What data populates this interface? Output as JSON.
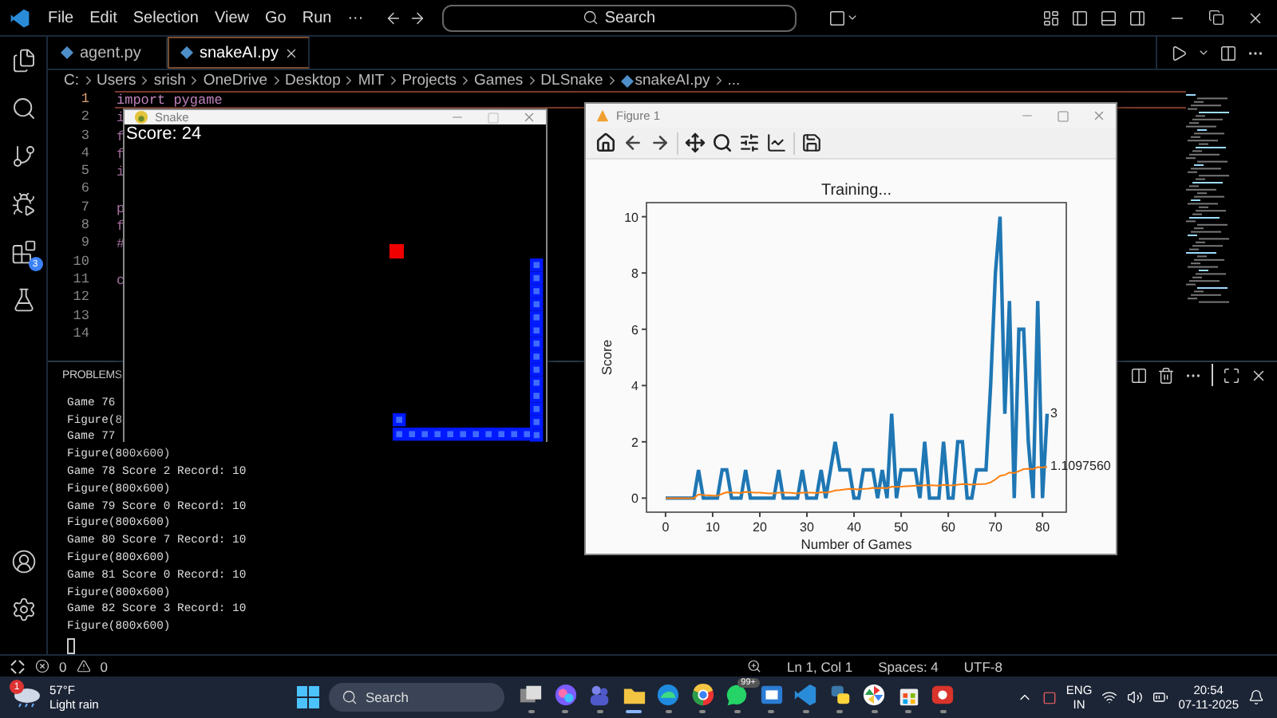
{
  "titlebar": {
    "menus": [
      "File",
      "Edit",
      "Selection",
      "View",
      "Go",
      "Run",
      "···"
    ],
    "search": {
      "placeholder": "Search"
    }
  },
  "activity_bar": {
    "extensions_badge": "3"
  },
  "tabs": [
    {
      "label": "agent.py",
      "selected": false
    },
    {
      "label": "snakeAI.py",
      "selected": true
    }
  ],
  "breadcrumb": [
    "C:",
    "Users",
    "srish",
    "OneDrive",
    "Desktop",
    "MIT",
    "Projects",
    "Games",
    "DLSnake",
    "snakeAI.py",
    "..."
  ],
  "editor": {
    "lines": [
      {
        "number": "1",
        "text": "import pygame",
        "current": true
      },
      {
        "number": "2",
        "text": "i",
        "current": false
      },
      {
        "number": "3",
        "text": "f",
        "current": false
      },
      {
        "number": "4",
        "text": "f",
        "current": false
      },
      {
        "number": "5",
        "text": "i",
        "current": false
      },
      {
        "number": "6",
        "current": false
      },
      {
        "number": "7",
        "text": "p",
        "current": false
      },
      {
        "number": "8",
        "text": "f",
        "current": false
      },
      {
        "number": "9",
        "text": "#",
        "current": false
      },
      {
        "number": "10",
        "current": false
      },
      {
        "number": "11",
        "text": "c",
        "current": false
      },
      {
        "number": "12",
        "current": false
      },
      {
        "number": "13",
        "current": false
      },
      {
        "number": "14",
        "current": false
      }
    ]
  },
  "panel": {
    "tab": "PROBLEMS",
    "terminal_lines": [
      "Game 76",
      "Figure(8",
      "Game 77",
      "Figure(800x600)",
      "Game 78 Score 2 Record: 10",
      "Figure(800x600)",
      "Game 79 Score 0 Record: 10",
      "Figure(800x600)",
      "Game 80 Score 7 Record: 10",
      "Figure(800x600)",
      "Game 81 Score 0 Record: 10",
      "Figure(800x600)",
      "Game 82 Score 3 Record: 10",
      "Figure(800x600)"
    ]
  },
  "snake_window": {
    "title": "Snake",
    "score": "Score: 24"
  },
  "figure_window": {
    "title": "Figure 1",
    "chart_data": {
      "type": "line",
      "title": "Training...",
      "xlabel": "Number of Games",
      "ylabel": "Score",
      "x": [
        0,
        1,
        2,
        3,
        4,
        5,
        6,
        7,
        8,
        9,
        10,
        11,
        12,
        13,
        14,
        15,
        16,
        17,
        18,
        19,
        20,
        21,
        22,
        23,
        24,
        25,
        26,
        27,
        28,
        29,
        30,
        31,
        32,
        33,
        34,
        35,
        36,
        37,
        38,
        39,
        40,
        41,
        42,
        43,
        44,
        45,
        46,
        47,
        48,
        49,
        50,
        51,
        52,
        53,
        54,
        55,
        56,
        57,
        58,
        59,
        60,
        61,
        62,
        63,
        64,
        65,
        66,
        67,
        68,
        69,
        70,
        71,
        72,
        73,
        74,
        75,
        76,
        77,
        78,
        79,
        80,
        81
      ],
      "series": [
        {
          "color": "#1f77b4",
          "values": [
            0,
            0,
            0,
            0,
            0,
            0,
            0,
            1,
            0,
            0,
            0,
            0,
            1,
            1,
            0,
            0,
            0,
            1,
            0,
            0,
            0,
            0,
            0,
            0,
            1,
            0,
            0,
            0,
            0,
            1,
            0,
            0,
            0,
            1,
            0,
            1,
            2,
            1,
            1,
            1,
            0,
            0,
            1,
            1,
            1,
            0,
            1,
            0,
            3,
            0,
            1,
            1,
            1,
            1,
            0,
            2,
            0,
            0,
            0,
            2,
            0,
            0,
            2,
            2,
            0,
            0,
            1,
            1,
            1,
            4,
            8,
            10,
            3,
            7,
            0,
            6,
            6,
            2,
            0,
            7,
            0,
            3
          ]
        },
        {
          "color": "#ff7f0e",
          "values": [
            0,
            0,
            0,
            0,
            0,
            0,
            0,
            0.13,
            0.11,
            0.1,
            0.09,
            0.08,
            0.15,
            0.21,
            0.2,
            0.19,
            0.18,
            0.22,
            0.21,
            0.2,
            0.19,
            0.18,
            0.17,
            0.17,
            0.2,
            0.19,
            0.19,
            0.18,
            0.17,
            0.2,
            0.19,
            0.19,
            0.18,
            0.21,
            0.2,
            0.22,
            0.27,
            0.29,
            0.31,
            0.33,
            0.32,
            0.31,
            0.33,
            0.34,
            0.36,
            0.35,
            0.36,
            0.35,
            0.41,
            0.4,
            0.41,
            0.42,
            0.43,
            0.44,
            0.44,
            0.46,
            0.46,
            0.45,
            0.44,
            0.47,
            0.46,
            0.45,
            0.48,
            0.5,
            0.49,
            0.48,
            0.49,
            0.5,
            0.51,
            0.56,
            0.66,
            0.79,
            0.82,
            0.91,
            0.89,
            0.96,
            1.03,
            1.04,
            1.03,
            1.1,
            1.09,
            1.11
          ]
        }
      ],
      "xlim": [
        -4.05,
        85.05
      ],
      "ylim": [
        -0.5,
        10.5
      ],
      "xticks": [
        0,
        10,
        20,
        30,
        40,
        50,
        60,
        70,
        80
      ],
      "yticks": [
        0,
        2,
        4,
        6,
        8,
        10
      ],
      "annotations": [
        {
          "x": 81,
          "y": 3,
          "text": "3"
        },
        {
          "x": 81,
          "y": 1.11,
          "text": "1.1097560"
        }
      ]
    }
  },
  "status_bar": {
    "errors": "0",
    "warnings": "0",
    "position": "Ln 1, Col 1",
    "spaces": "Spaces: 4",
    "encoding": "UTF-8"
  },
  "taskbar": {
    "weather": {
      "badge": "1",
      "temperature": "57°F",
      "condition": "Light rain"
    },
    "search": {
      "placeholder": "Search"
    },
    "apps": [
      {
        "kind": "taskview",
        "selected": false
      },
      {
        "kind": "swirl",
        "selected": false
      },
      {
        "kind": "people",
        "selected": false
      },
      {
        "kind": "folder",
        "selected": true
      },
      {
        "kind": "wave",
        "selected": false
      },
      {
        "kind": "ring",
        "selected": false
      },
      {
        "kind": "chat",
        "selected": false,
        "badge": "99+"
      },
      {
        "kind": "tile",
        "selected": false
      },
      {
        "kind": "code",
        "selected": false
      },
      {
        "kind": "snake",
        "selected": false
      },
      {
        "kind": "pinwheel",
        "selected": false
      },
      {
        "kind": "bag",
        "selected": false
      },
      {
        "kind": "record",
        "selected": false
      }
    ],
    "language": [
      "ENG",
      "IN"
    ],
    "time": "20:54",
    "date": "07-11-2025"
  }
}
